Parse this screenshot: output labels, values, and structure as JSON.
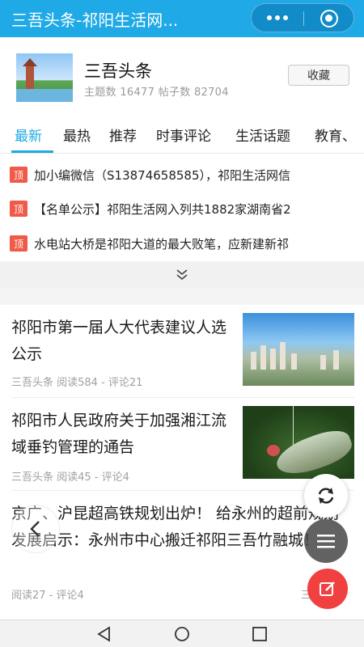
{
  "topbar": {
    "title": "三吾头条-祁阳生活网..."
  },
  "forum": {
    "name": "三吾头条",
    "stats": "主题数 16477 帖子数 82704",
    "favorite_label": "收藏"
  },
  "tabs": [
    {
      "label": "最新",
      "active": true
    },
    {
      "label": "最热"
    },
    {
      "label": "推荐"
    },
    {
      "label": "时事评论"
    },
    {
      "label": "生活话题"
    },
    {
      "label": "教育、"
    }
  ],
  "pinned": [
    {
      "tag": "顶",
      "text": "加小编微信（S13874658585），祁阳生活网信"
    },
    {
      "tag": "顶",
      "text": "【名单公示】祁阳生活网入列共1882家湖南省2"
    },
    {
      "tag": "顶",
      "text": "水电站大桥是祁阳大道的最大败笔，应新建新祁"
    }
  ],
  "articles": [
    {
      "title": "祁阳市第一届人大代表建议人选公示",
      "meta": "三吾头条  阅读584 - 评论21"
    },
    {
      "title": "祁阳市人民政府关于加强湘江流域垂钓管理的通告",
      "meta": "三吾头条  阅读45 - 评论4"
    },
    {
      "title": "京广、沪昆超高铁规划出炉！ 给永州的超前规划发展启示：永州市中心搬迁祁阳三吾竹融城！",
      "meta": "阅读27 - 评论4",
      "meta_right": "三吾头条"
    }
  ],
  "colors": {
    "accent": "#1fa9e6",
    "pin_tag": "#f05a46",
    "compose": "#f04040"
  }
}
